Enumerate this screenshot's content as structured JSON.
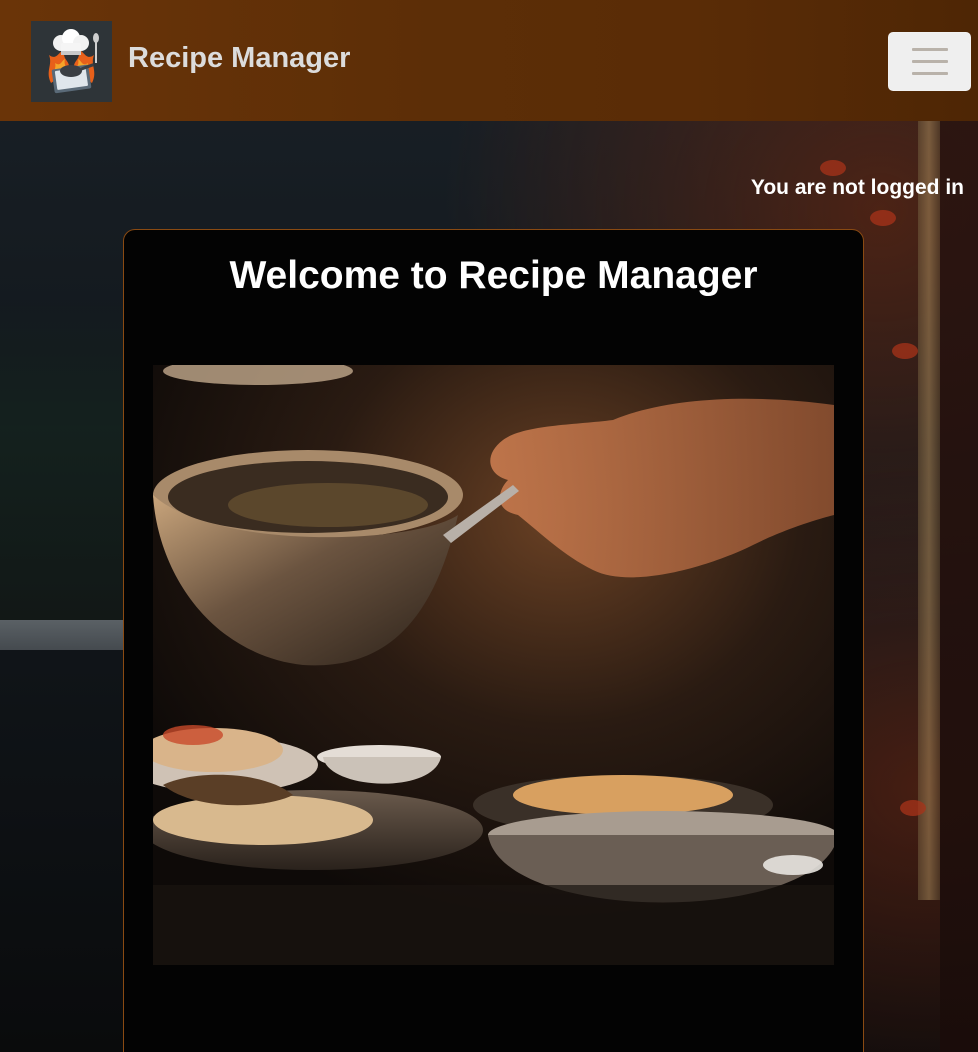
{
  "navbar": {
    "brand": "Recipe Manager",
    "logo_icon": "chef-hat-cookbook-logo",
    "menu_icon": "hamburger-menu-icon"
  },
  "auth": {
    "status": "You are not logged in"
  },
  "welcome": {
    "title": "Welcome to Recipe Manager",
    "image_icon": "cooking-pan-serving-photo"
  },
  "colors": {
    "navbar": "#5c2e07",
    "card_background": "#030303",
    "card_border": "#8a4a12",
    "text": "#ffffff",
    "brand_text": "#dcdcdc"
  }
}
